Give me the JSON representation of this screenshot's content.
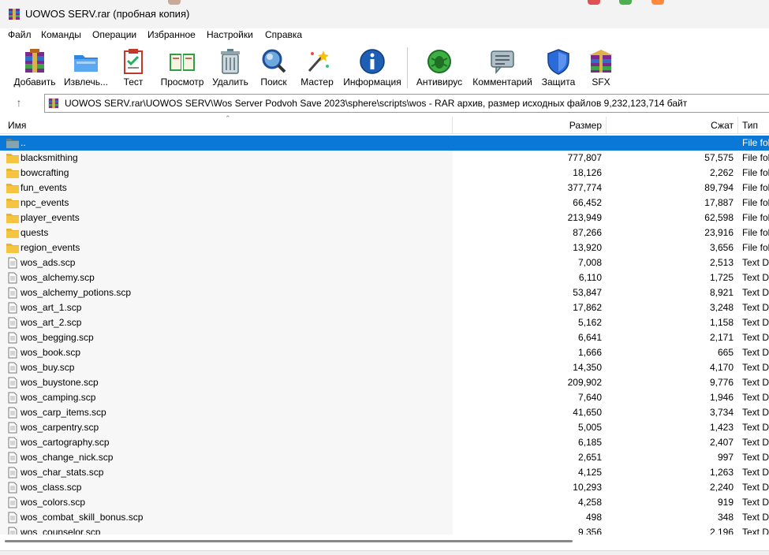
{
  "window": {
    "title": "UOWOS SERV.rar (пробная копия)"
  },
  "menu": [
    "Файл",
    "Команды",
    "Операции",
    "Избранное",
    "Настройки",
    "Справка"
  ],
  "toolbar": [
    {
      "label": "Добавить",
      "icon": "add-archive-icon"
    },
    {
      "label": "Извлечь...",
      "icon": "extract-folder-icon"
    },
    {
      "label": "Тест",
      "icon": "test-clipboard-icon"
    },
    {
      "label": "Просмотр",
      "icon": "view-book-icon"
    },
    {
      "label": "Удалить",
      "icon": "trash-icon"
    },
    {
      "label": "Поиск",
      "icon": "magnifier-icon"
    },
    {
      "label": "Мастер",
      "icon": "wizard-wand-icon"
    },
    {
      "label": "Информация",
      "icon": "info-icon"
    },
    {
      "label": "Антивирус",
      "icon": "bug-shield-icon"
    },
    {
      "label": "Комментарий",
      "icon": "comment-bubble-icon"
    },
    {
      "label": "Защита",
      "icon": "protect-shield-icon"
    },
    {
      "label": "SFX",
      "icon": "sfx-box-icon"
    }
  ],
  "address": {
    "path": "UOWOS SERV.rar\\UOWOS SERV\\Wos Server Podvoh Save 2023\\sphere\\scripts\\wos - RAR архив, размер исходных файлов 9,232,123,714 байт"
  },
  "columns": {
    "name": "Имя",
    "size": "Размер",
    "packed": "Сжат",
    "type": "Тип"
  },
  "colors": {
    "selection": "#0a78d7",
    "folder": "#f5c542",
    "accent": "#0067c0"
  },
  "files": [
    {
      "name": "..",
      "size": "",
      "packed": "",
      "type": "File fol",
      "kind": "up"
    },
    {
      "name": "blacksmithing",
      "size": "777,807",
      "packed": "57,575",
      "type": "File fol",
      "kind": "folder"
    },
    {
      "name": "bowcrafting",
      "size": "18,126",
      "packed": "2,262",
      "type": "File fol",
      "kind": "folder"
    },
    {
      "name": "fun_events",
      "size": "377,774",
      "packed": "89,794",
      "type": "File fol",
      "kind": "folder"
    },
    {
      "name": "npc_events",
      "size": "66,452",
      "packed": "17,887",
      "type": "File fol",
      "kind": "folder"
    },
    {
      "name": "player_events",
      "size": "213,949",
      "packed": "62,598",
      "type": "File fol",
      "kind": "folder"
    },
    {
      "name": "quests",
      "size": "87,266",
      "packed": "23,916",
      "type": "File fol",
      "kind": "folder"
    },
    {
      "name": "region_events",
      "size": "13,920",
      "packed": "3,656",
      "type": "File fol",
      "kind": "folder"
    },
    {
      "name": "wos_ads.scp",
      "size": "7,008",
      "packed": "2,513",
      "type": "Text Do",
      "kind": "file"
    },
    {
      "name": "wos_alchemy.scp",
      "size": "6,110",
      "packed": "1,725",
      "type": "Text Do",
      "kind": "file"
    },
    {
      "name": "wos_alchemy_potions.scp",
      "size": "53,847",
      "packed": "8,921",
      "type": "Text Do",
      "kind": "file"
    },
    {
      "name": "wos_art_1.scp",
      "size": "17,862",
      "packed": "3,248",
      "type": "Text Do",
      "kind": "file"
    },
    {
      "name": "wos_art_2.scp",
      "size": "5,162",
      "packed": "1,158",
      "type": "Text Do",
      "kind": "file"
    },
    {
      "name": "wos_begging.scp",
      "size": "6,641",
      "packed": "2,171",
      "type": "Text Do",
      "kind": "file"
    },
    {
      "name": "wos_book.scp",
      "size": "1,666",
      "packed": "665",
      "type": "Text Do",
      "kind": "file"
    },
    {
      "name": "wos_buy.scp",
      "size": "14,350",
      "packed": "4,170",
      "type": "Text Do",
      "kind": "file"
    },
    {
      "name": "wos_buystone.scp",
      "size": "209,902",
      "packed": "9,776",
      "type": "Text Do",
      "kind": "file"
    },
    {
      "name": "wos_camping.scp",
      "size": "7,640",
      "packed": "1,946",
      "type": "Text Do",
      "kind": "file"
    },
    {
      "name": "wos_carp_items.scp",
      "size": "41,650",
      "packed": "3,734",
      "type": "Text Do",
      "kind": "file"
    },
    {
      "name": "wos_carpentry.scp",
      "size": "5,005",
      "packed": "1,423",
      "type": "Text Do",
      "kind": "file"
    },
    {
      "name": "wos_cartography.scp",
      "size": "6,185",
      "packed": "2,407",
      "type": "Text Do",
      "kind": "file"
    },
    {
      "name": "wos_change_nick.scp",
      "size": "2,651",
      "packed": "997",
      "type": "Text Do",
      "kind": "file"
    },
    {
      "name": "wos_char_stats.scp",
      "size": "4,125",
      "packed": "1,263",
      "type": "Text Do",
      "kind": "file"
    },
    {
      "name": "wos_class.scp",
      "size": "10,293",
      "packed": "2,240",
      "type": "Text Do",
      "kind": "file"
    },
    {
      "name": "wos_colors.scp",
      "size": "4,258",
      "packed": "919",
      "type": "Text Do",
      "kind": "file"
    },
    {
      "name": "wos_combat_skill_bonus.scp",
      "size": "498",
      "packed": "348",
      "type": "Text Do",
      "kind": "file"
    },
    {
      "name": "wos_counselor.scp",
      "size": "9,356",
      "packed": "2,196",
      "type": "Text Do",
      "kind": "file"
    }
  ]
}
